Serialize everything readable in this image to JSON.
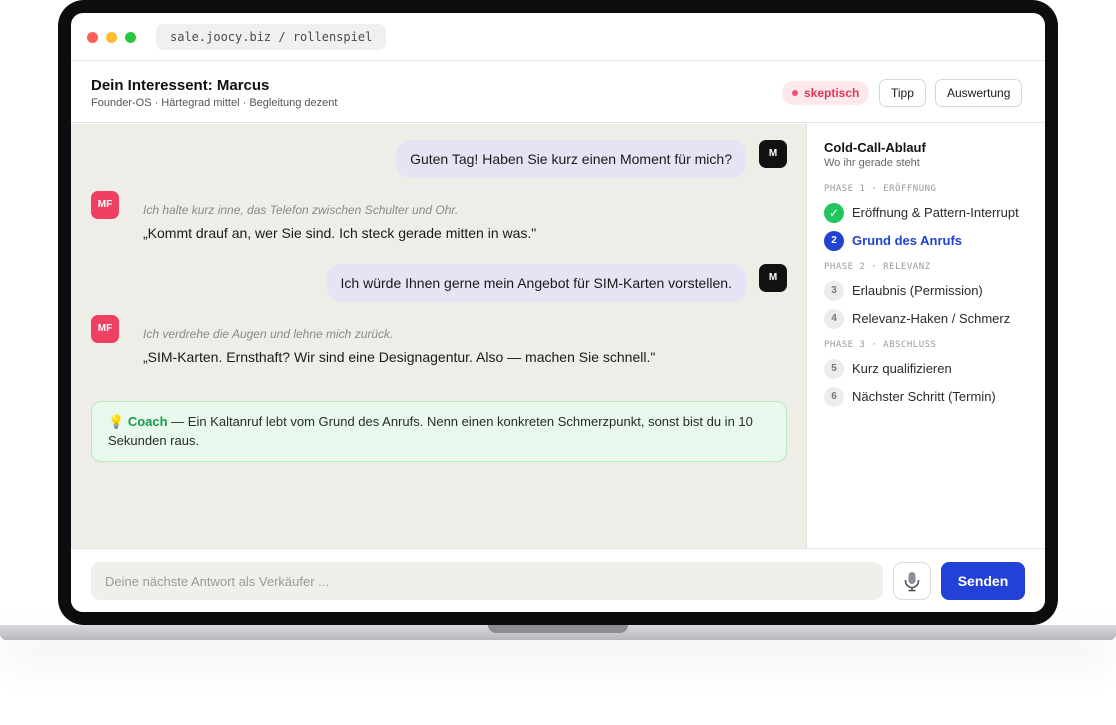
{
  "browser": {
    "url": "sale.joocy.biz / rollenspiel"
  },
  "header": {
    "title": "Dein Interessent: Marcus",
    "subtitle": "Founder-OS · Härtegrad mittel · Begleitung dezent",
    "mood_badge": "skeptisch",
    "tip_button": "Tipp",
    "evaluation_button": "Auswertung"
  },
  "chat": {
    "me_avatar": "M",
    "lead_avatar": "MF",
    "messages": [
      {
        "from": "me",
        "text": "Guten Tag! Haben Sie kurz einen Moment für mich?"
      },
      {
        "from": "lead",
        "action": "Ich halte kurz inne, das Telefon zwischen Schulter und Ohr.",
        "text": "„Kommt drauf an, wer Sie sind. Ich steck gerade mitten in was.\""
      },
      {
        "from": "me",
        "text": "Ich würde Ihnen gerne mein Angebot für SIM-Karten vorstellen."
      },
      {
        "from": "lead",
        "action": "Ich verdrehe die Augen und lehne mich zurück.",
        "text": "„SIM-Karten. Ernsthaft? Wir sind eine Designagentur. Also — machen Sie schnell.\""
      }
    ],
    "coach": {
      "icon": "💡",
      "label": "Coach",
      "text": " — Ein Kaltanruf lebt vom Grund des Anrufs. Nenn einen konkreten Schmerzpunkt, sonst bist du in 10 Sekunden raus."
    }
  },
  "sidebar": {
    "title": "Cold-Call-Ablauf",
    "subtitle": "Wo ihr gerade steht",
    "phases": [
      {
        "label": "PHASE 1 · ERÖFFNUNG",
        "steps": [
          {
            "num": "✓",
            "label": "Eröffnung & Pattern-Interrupt",
            "state": "done"
          },
          {
            "num": "2",
            "label": "Grund des Anrufs",
            "state": "active"
          }
        ]
      },
      {
        "label": "PHASE 2 · RELEVANZ",
        "steps": [
          {
            "num": "3",
            "label": "Erlaubnis (Permission)",
            "state": "todo"
          },
          {
            "num": "4",
            "label": "Relevanz-Haken / Schmerz",
            "state": "todo"
          }
        ]
      },
      {
        "label": "PHASE 3 · ABSCHLUSS",
        "steps": [
          {
            "num": "5",
            "label": "Kurz qualifizieren",
            "state": "todo"
          },
          {
            "num": "6",
            "label": "Nächster Schritt (Termin)",
            "state": "todo"
          }
        ]
      }
    ]
  },
  "composer": {
    "placeholder": "Deine nächste Antwort als Verkäufer ...",
    "mic_icon": "microphone-icon",
    "send_label": "Senden"
  }
}
